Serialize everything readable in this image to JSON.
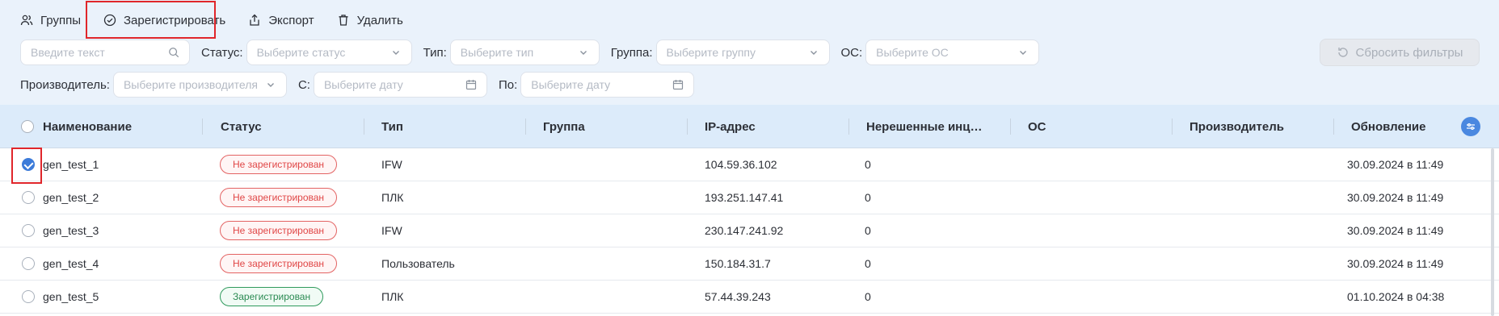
{
  "toolbar": {
    "groups_label": "Группы",
    "register_label": "Зарегистрировать",
    "export_label": "Экспорт",
    "delete_label": "Удалить"
  },
  "filters": {
    "search_placeholder": "Введите текст",
    "status_label": "Статус",
    "status_placeholder": "Выберите статус",
    "type_label": "Тип",
    "type_placeholder": "Выберите тип",
    "group_label": "Группа",
    "group_placeholder": "Выберите группу",
    "os_label": "ОС",
    "os_placeholder": "Выберите ОС",
    "vendor_label": "Производитель",
    "vendor_placeholder": "Выберите производителя",
    "from_label": "С",
    "from_placeholder": "Выберите дату",
    "to_label": "По",
    "to_placeholder": "Выберите дату",
    "reset_label": "Сбросить фильтры"
  },
  "table": {
    "columns": [
      "Наименование",
      "Статус",
      "Тип",
      "Группа",
      "IP-адрес",
      "Нерешенные инц…",
      "ОС",
      "Производитель",
      "Обновление"
    ],
    "rows": [
      {
        "name": "gen_test_1",
        "status": "Не зарегистрирован",
        "registered": false,
        "type": "IFW",
        "group": "",
        "ip": "104.59.36.102",
        "incidents": "0",
        "os": "",
        "vendor": "",
        "updated": "30.09.2024 в 11:49",
        "checked": true
      },
      {
        "name": "gen_test_2",
        "status": "Не зарегистрирован",
        "registered": false,
        "type": "ПЛК",
        "group": "",
        "ip": "193.251.147.41",
        "incidents": "0",
        "os": "",
        "vendor": "",
        "updated": "30.09.2024 в 11:49",
        "checked": false
      },
      {
        "name": "gen_test_3",
        "status": "Не зарегистрирован",
        "registered": false,
        "type": "IFW",
        "group": "",
        "ip": "230.147.241.92",
        "incidents": "0",
        "os": "",
        "vendor": "",
        "updated": "30.09.2024 в 11:49",
        "checked": false
      },
      {
        "name": "gen_test_4",
        "status": "Не зарегистрирован",
        "registered": false,
        "type": "Пользователь",
        "group": "",
        "ip": "150.184.31.7",
        "incidents": "0",
        "os": "",
        "vendor": "",
        "updated": "30.09.2024 в 11:49",
        "checked": false
      },
      {
        "name": "gen_test_5",
        "status": "Зарегистрирован",
        "registered": true,
        "type": "ПЛК",
        "group": "",
        "ip": "57.44.39.243",
        "incidents": "0",
        "os": "",
        "vendor": "",
        "updated": "01.10.2024 в 04:38",
        "checked": false
      }
    ]
  },
  "colors": {
    "accent": "#3c7bd9",
    "highlight": "#e0262b",
    "unregistered": "#e04646",
    "registered": "#2a8a52"
  },
  "icons": {
    "groups": "users-icon",
    "register": "check-circle-icon",
    "export": "export-icon",
    "delete": "trash-icon",
    "search": "search-icon",
    "date": "calendar-icon",
    "reset": "refresh-icon",
    "settings": "sliders-icon"
  }
}
